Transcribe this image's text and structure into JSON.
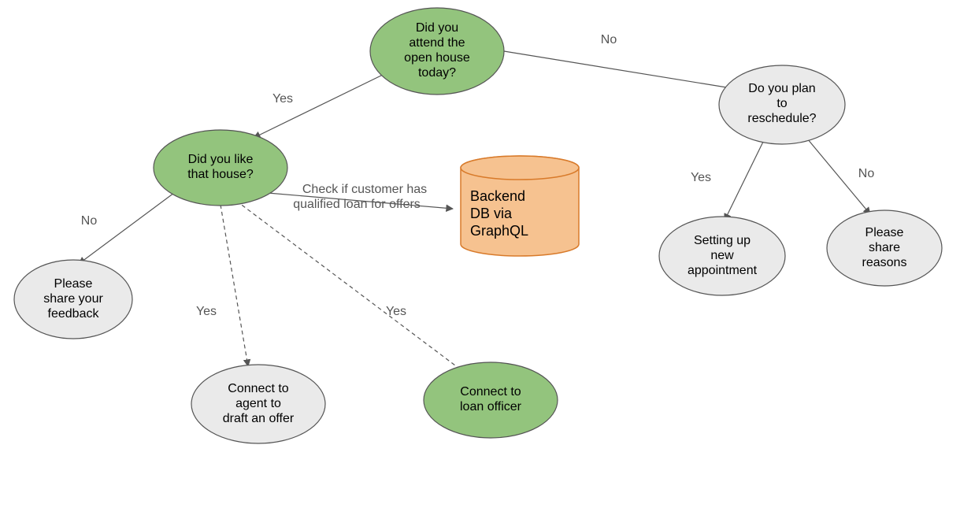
{
  "nodes": {
    "attend": {
      "lines": [
        "Did you",
        "attend the",
        "open house",
        "today?"
      ]
    },
    "like": {
      "lines": [
        "Did you like",
        "that house?"
      ]
    },
    "reschedule": {
      "lines": [
        "Do you plan",
        "to",
        "reschedule?"
      ]
    },
    "feedback": {
      "lines": [
        "Please",
        "share your",
        "feedback"
      ]
    },
    "agent": {
      "lines": [
        "Connect to",
        "agent to",
        "draft an offer"
      ]
    },
    "loanofficer": {
      "lines": [
        "Connect to",
        "loan officer"
      ]
    },
    "newappt": {
      "lines": [
        "Setting up",
        "new",
        "appointment"
      ]
    },
    "reasons": {
      "lines": [
        "Please",
        "share",
        "reasons"
      ]
    },
    "db": {
      "lines": [
        "Backend",
        "DB via",
        "GraphQL"
      ]
    }
  },
  "edges": {
    "attend_yes": "Yes",
    "attend_no": "No",
    "like_no": "No",
    "like_check_l1": "Check if customer has",
    "like_check_l2": "qualified loan for offers",
    "like_yes_agent": "Yes",
    "like_yes_loan": "Yes",
    "resched_yes": "Yes",
    "resched_no": "No"
  }
}
